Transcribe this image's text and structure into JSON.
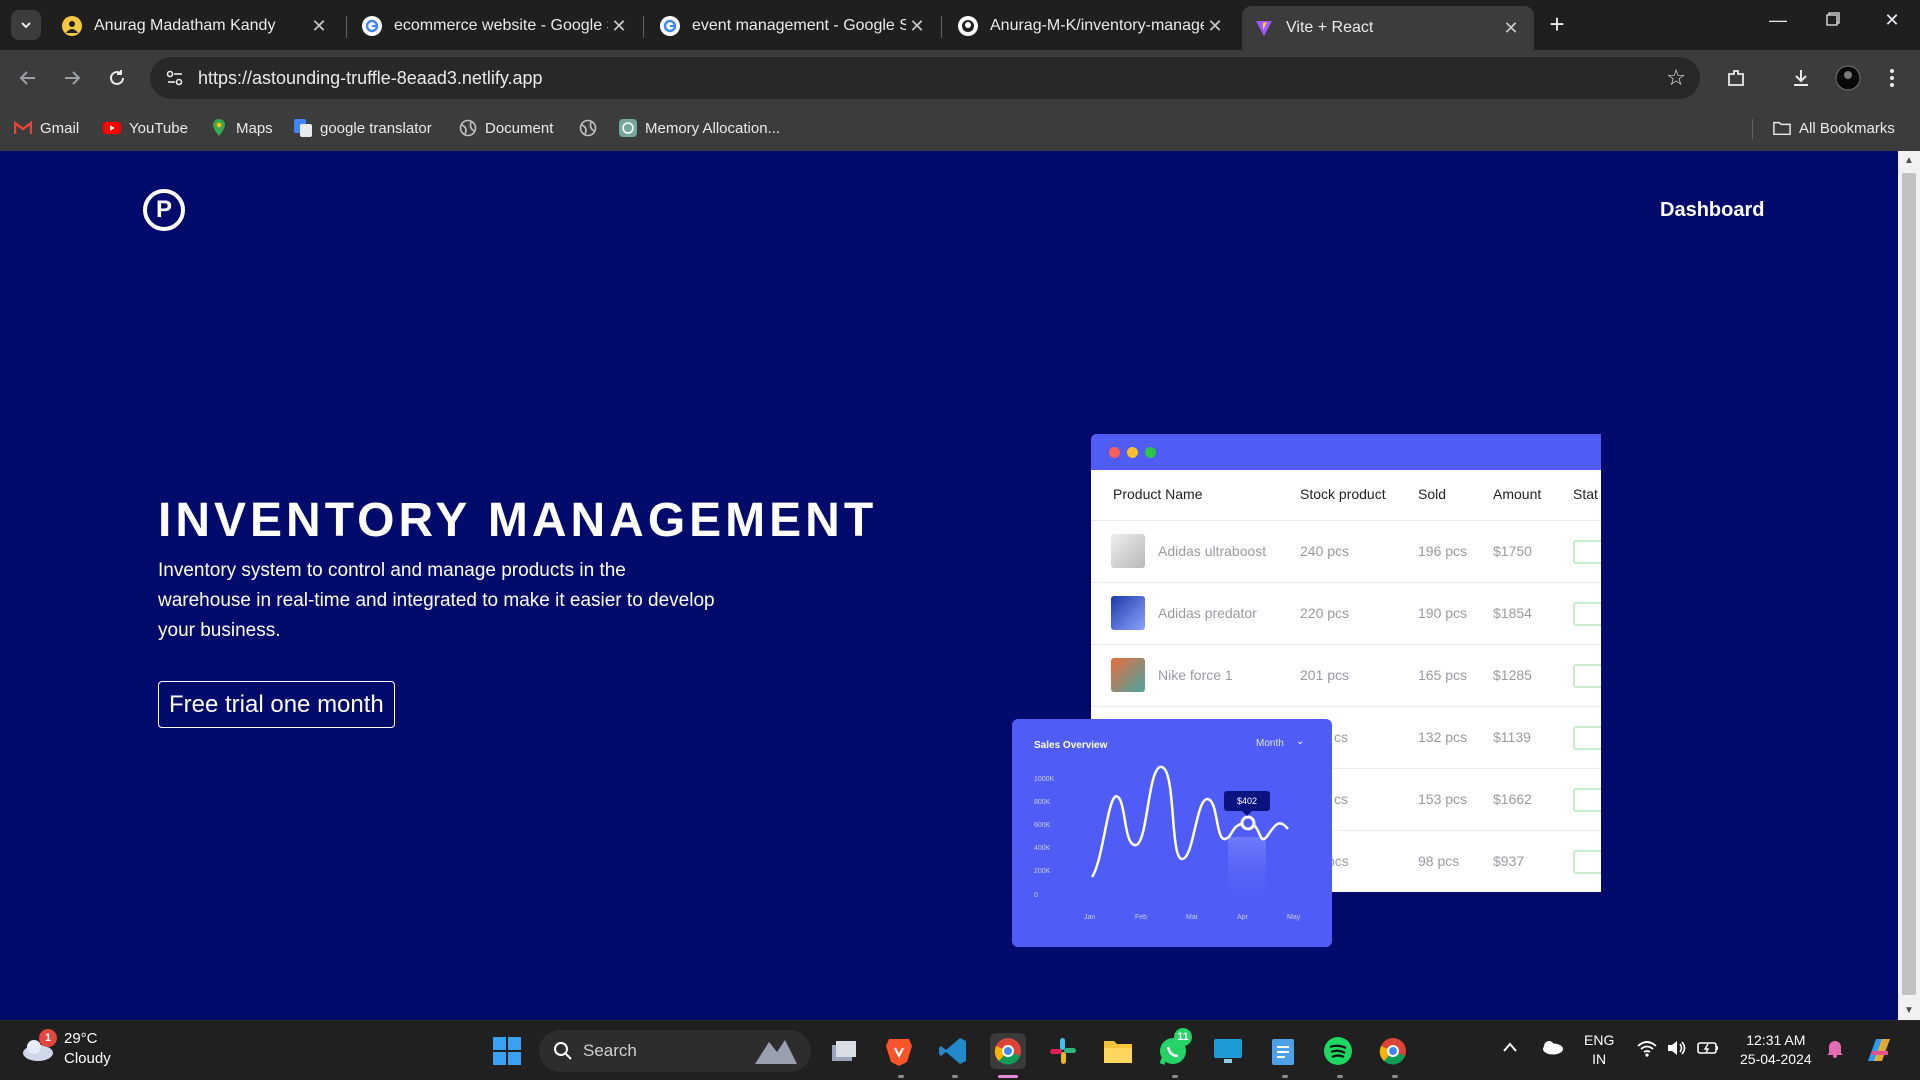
{
  "browser": {
    "tabs": [
      {
        "title": "Anurag Madatham Kandy",
        "icon": "profile-icon"
      },
      {
        "title": "ecommerce website - Google Search",
        "icon": "google-icon"
      },
      {
        "title": "event management - Google Search",
        "icon": "google-icon"
      },
      {
        "title": "Anurag-M-K/inventory-management",
        "icon": "github-icon"
      },
      {
        "title": "Vite + React",
        "icon": "vite-icon",
        "active": true
      }
    ],
    "url": "https://astounding-truffle-8eaad3.netlify.app",
    "bookmarks": [
      "Gmail",
      "YouTube",
      "Maps",
      "google translator",
      "Document",
      "Memory Allocation..."
    ],
    "all_bookmarks": "All Bookmarks"
  },
  "page": {
    "logo_letter": "P",
    "nav_link": "Dashboard",
    "hero_title": "INVENTORY MANAGEMENT",
    "hero_description": "Inventory system to control and manage products in the warehouse in real-time and integrated to make it easier to develop your business.",
    "cta_label": "Free trial one month",
    "table": {
      "headers": [
        "Product Name",
        "Stock product",
        "Sold",
        "Amount",
        "Stat"
      ],
      "rows": [
        {
          "name": "Adidas ultraboost",
          "stock": "240 pcs",
          "sold": "196 pcs",
          "amount": "$1750"
        },
        {
          "name": "Adidas predator",
          "stock": "220 pcs",
          "sold": "190 pcs",
          "amount": "$1854"
        },
        {
          "name": "Nike force 1",
          "stock": "201 pcs",
          "sold": "165 pcs",
          "amount": "$1285"
        },
        {
          "name": "",
          "stock": "cs",
          "sold": "132 pcs",
          "amount": "$1139"
        },
        {
          "name": "",
          "stock": "cs",
          "sold": "153 pcs",
          "amount": "$1662"
        },
        {
          "name": "",
          "stock": "pcs",
          "sold": "98 pcs",
          "amount": "$937"
        }
      ]
    },
    "sales_overview": {
      "title": "Sales Overview",
      "period": "Month",
      "tooltip": "$402",
      "y_ticks": [
        "1000K",
        "800K",
        "600K",
        "400K",
        "200K",
        "0"
      ],
      "x_ticks": [
        "Jan",
        "Feb",
        "Mar",
        "Apr",
        "May"
      ]
    }
  },
  "taskbar": {
    "weather_temp": "29°C",
    "weather_desc": "Cloudy",
    "weather_badge": "1",
    "search_label": "Search",
    "whatsapp_badge": "11",
    "lang_line1": "ENG",
    "lang_line2": "IN",
    "time": "12:31 AM",
    "date": "25-04-2024"
  },
  "colors": {
    "page_bg": "#020b6c",
    "accent": "#4f5cf5",
    "browser_frame": "#3c3c3c"
  }
}
